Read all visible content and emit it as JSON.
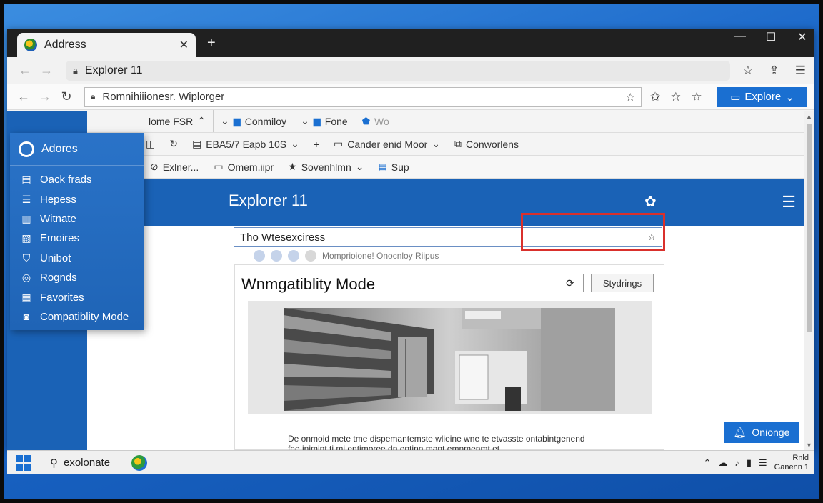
{
  "window": {
    "tab_title": "Address",
    "tab_close": "✕",
    "new_tab": "+",
    "minimize": "—",
    "maximize": "☐",
    "close": "✕"
  },
  "address_bar_1": {
    "value": "Explorer 11"
  },
  "address_bar_2": {
    "value": "Romnihiiionesr. Wiplorger",
    "explore_button": "Explore"
  },
  "favorites_bar": {
    "items": [
      "lome FSR",
      "Conmiloy",
      "Fone",
      "Wo"
    ]
  },
  "command_bar": {
    "items": [
      "EBA5/7 Eapb 10S",
      "Cander enid Moor",
      "Conworlens"
    ]
  },
  "links_bar": {
    "items": [
      "Exlner...",
      "Omem.iipr",
      "Sovenhlmn",
      "Sup"
    ]
  },
  "page_header": {
    "title": "Explorer 11"
  },
  "search": {
    "value": "Tho Wtesexciress"
  },
  "suggestion_text": "Momprioione! Onocnloy Riipus",
  "card": {
    "title": "Wnmgatiblity Mode",
    "secondary_button": "Stydrings",
    "caption_line1": "De onmoid mete tme dispemantemste wlieine wne te etvasste ontabintgenend",
    "caption_line2": "fae inimint ti mi entimoree dn entinn mant emnmenmt et"
  },
  "float_button": "Onionge",
  "flyout": {
    "header": "Adores",
    "items": [
      {
        "label": "Oack frads",
        "icon": "list-icon"
      },
      {
        "label": "Hepess",
        "icon": "lines-icon"
      },
      {
        "label": "Witnate",
        "icon": "chart-icon"
      },
      {
        "label": "Emoires",
        "icon": "waveform-icon"
      },
      {
        "label": "Unibot",
        "icon": "shield-icon"
      },
      {
        "label": "Rognds",
        "icon": "location-icon"
      },
      {
        "label": "Favorites",
        "icon": "grid-icon"
      },
      {
        "label": "Compatiblity Mode",
        "icon": "camera-icon"
      }
    ]
  },
  "taskbar": {
    "search_text": "exolonate",
    "clock_time": "Rnld",
    "clock_date": "Ganenn 1"
  },
  "colors": {
    "accent": "#1a6fd1",
    "header_blue": "#1a62b6",
    "highlight_red": "#d9302c"
  }
}
